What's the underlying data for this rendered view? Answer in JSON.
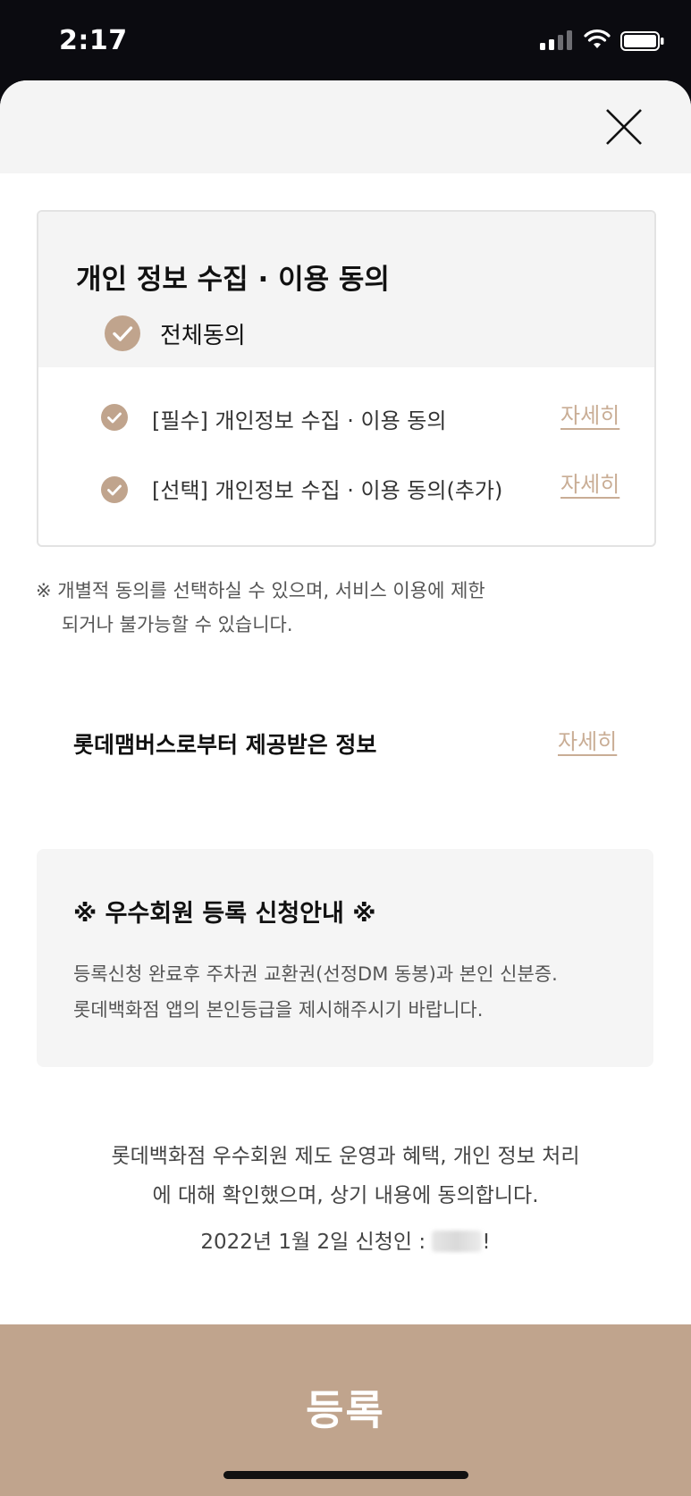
{
  "status_bar": {
    "time": "2:17"
  },
  "sheet": {
    "consent": {
      "title": "개인 정보 수집 · 이용 동의",
      "all_label": "전체동의",
      "items": [
        {
          "label": "[필수] 개인정보 수집 · 이용 동의",
          "detail": "자세히"
        },
        {
          "label": "[선택] 개인정보 수집 · 이용 동의(추가)",
          "detail": "자세히"
        }
      ]
    },
    "notice": {
      "line1": "※ 개별적 동의를 선택하실 수 있으며, 서비스 이용에 제한",
      "line2": "되거나 불가능할 수 있습니다."
    },
    "member_info": {
      "title": "롯데맴버스로부터 제공받은 정보",
      "detail": "자세히"
    },
    "guide": {
      "title": "※ 우수회원 등록 신청안내 ※",
      "line1": "등록신청 완료후 주차권 교환권(선정DM 동봉)과 본인 신분증.",
      "line2": "롯데백화점 앱의 본인등급을 제시해주시기 바랍니다."
    },
    "confirm": {
      "line1": "롯데백화점 우수회원 제도 운영과 혜택, 개인 정보 처리",
      "line2": "에 대해 확인했으며, 상기 내용에 동의합니다.",
      "apply_prefix": "2022년 1월 2일 신청인 : ",
      "apply_suffix": "!"
    },
    "register_label": "등록"
  },
  "colors": {
    "accent": "#c0a48d",
    "link": "#c9ad95",
    "header_bg": "#f4f4f4"
  },
  "icons": [
    "cellular-signal-icon",
    "wifi-icon",
    "battery-icon",
    "close-icon",
    "check-icon"
  ]
}
